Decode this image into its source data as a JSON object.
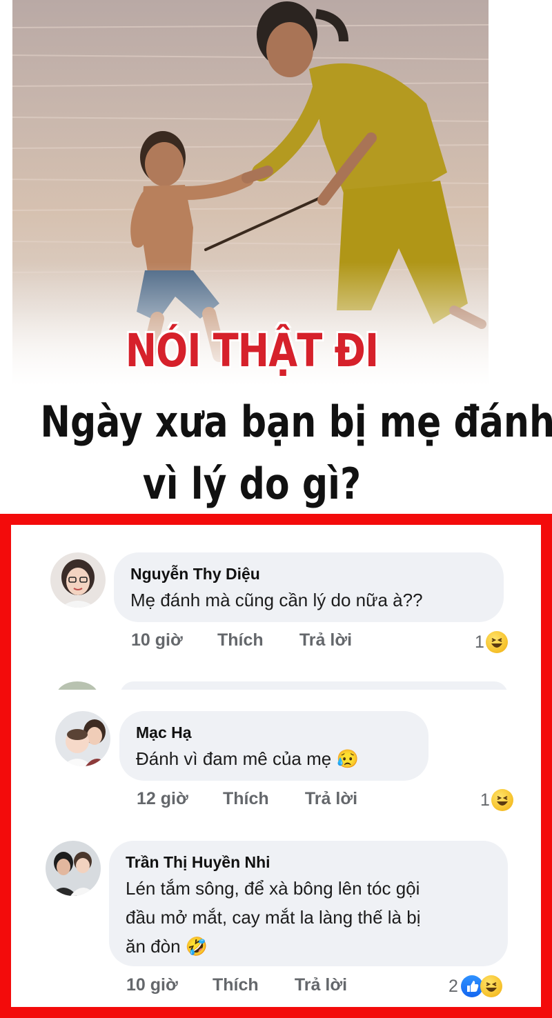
{
  "meme": {
    "headline": "NÓI THẬT ĐI",
    "question_line1": "Ngày xưa bạn bị mẹ đánh",
    "question_line2": "vì lý do gì?"
  },
  "comments": [
    {
      "author": "Nguyễn Thy Diệu",
      "lines": [
        "Mẹ đánh mà cũng cần lý do nữa à??"
      ],
      "time": "10 giờ",
      "like_label": "Thích",
      "reply_label": "Trả lời",
      "reaction_count": "1",
      "reactions": [
        "haha-icon"
      ]
    },
    {
      "author": "Mạc Hạ",
      "lines": [
        "Đánh vì đam mê của mẹ 😥"
      ],
      "time": "12 giờ",
      "like_label": "Thích",
      "reply_label": "Trả lời",
      "reaction_count": "1",
      "reactions": [
        "haha-icon"
      ]
    },
    {
      "author": "Trần Thị Huyền Nhi",
      "lines": [
        "Lén tắm sông, để xà bông lên tóc gội",
        "đầu mở mắt, cay mắt la làng thế là bị",
        "ăn đòn 🤣"
      ],
      "time": "10 giờ",
      "like_label": "Thích",
      "reply_label": "Trả lời",
      "reaction_count": "2",
      "reactions": [
        "like-icon",
        "haha-icon"
      ]
    }
  ],
  "colors": {
    "frame_red": "#f30b0b",
    "headline_red": "#d6212b",
    "bubble_gray": "#eff1f5",
    "meta_gray": "#64676b",
    "like_blue": "#1877f2"
  }
}
